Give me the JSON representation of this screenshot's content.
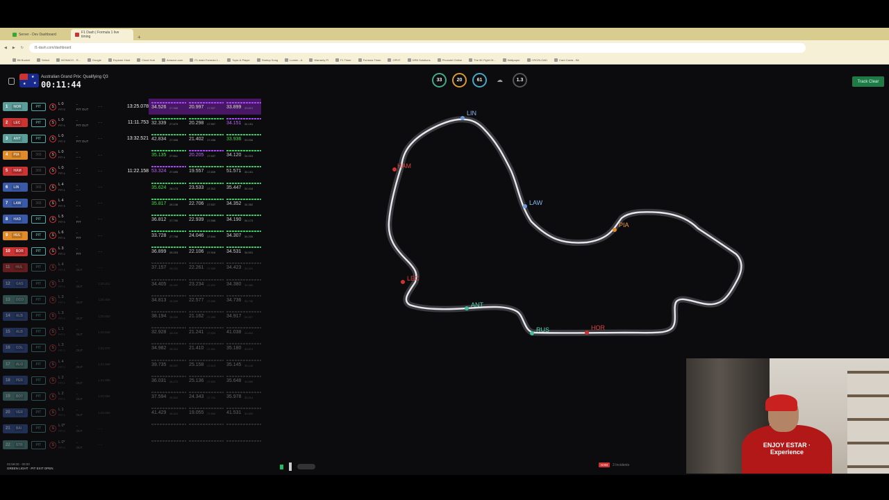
{
  "browser": {
    "tabs": [
      {
        "label": "Server - Dev Dashboard",
        "color": "#3a3"
      },
      {
        "label": "F1 Dash | Formula 1 live timing",
        "color": "#c33",
        "active": true
      }
    ],
    "new_tab": "+",
    "url": "f1-dash.com/dashboard",
    "bookmarks": [
      "Bit Bucket",
      "Select",
      "MONACO - R...",
      "Google",
      "Explorer Host",
      "Cloud Hub",
      "Amazon.com",
      "F1 dash Formula 1...",
      "Topic & Player",
      "Startup Song",
      "Lumen - A",
      "Warranty Fl",
      "F1 Timer",
      "Formula Timer",
      "OPHT",
      "DRB Solutions",
      "Phonotel Online",
      "The 5K Fight Of...",
      "Wallpaper",
      "CROSLOAD",
      "Card Cards - Bit"
    ]
  },
  "header": {
    "session_title": "Australian Grand Prix: Qualifying Q3",
    "session_timer": "00:11:44",
    "weather": {
      "air_temp": "33",
      "track_temp": "20",
      "humidity": "61",
      "rain_icon": "rain-cloud-icon",
      "wind": "1.3"
    },
    "track_status": "Track Clear"
  },
  "timing": {
    "drivers": [
      {
        "pos": "1",
        "code": "NOR",
        "color": "#5a9d9a",
        "drs": "PIT",
        "tyre": "S",
        "lap": "L 0",
        "lap_sub": "PIT 5",
        "gap": "–",
        "gap_sub": "PIT OUT",
        "interval": "– –",
        "best": "13:25.078",
        "s1": "34.526",
        "s1c": "yellow",
        "s1b": "purple",
        "s2": "20.997",
        "s2c": "yellow",
        "s2b": "purple",
        "s3": "33.899",
        "s3c": "yellow",
        "s3b": "purple",
        "s1s": "27.968",
        "s2s": "17.557",
        "s3s": "33.821",
        "highlight": true,
        "faded": false
      },
      {
        "pos": "2",
        "code": "LEC",
        "color": "#c33",
        "drs": "PIT",
        "tyre": "S",
        "lap": "L 0",
        "lap_sub": "PIT 4",
        "gap": "–",
        "gap_sub": "PIT OUT",
        "interval": "– –",
        "best": "11:11.753",
        "s1": "32.339",
        "s1c": "normal",
        "s1b": "green",
        "s2": "20.298",
        "s2c": "normal",
        "s2b": "green",
        "s3": "34.151",
        "s3c": "purple",
        "s3b": "purple",
        "s1s": "27.679",
        "s2s": "17.557",
        "s3s": "34.151",
        "highlight": false,
        "faded": false
      },
      {
        "pos": "3",
        "code": "ANT",
        "color": "#5a9d9a",
        "drs": "PIT",
        "tyre": "S",
        "lap": "L 0",
        "lap_sub": "PIT 3",
        "gap": "–",
        "gap_sub": "PIT OUT",
        "interval": "– –",
        "best": "13:32.521",
        "s1": "42.834",
        "s1c": "normal",
        "s1b": "green",
        "s2": "21.402",
        "s2c": "normal",
        "s2b": "green",
        "s3": "33.936",
        "s3c": "green",
        "s3b": "green",
        "s1s": "27.908",
        "s2s": "17.498",
        "s3s": "33.936",
        "highlight": false,
        "faded": false
      },
      {
        "pos": "4",
        "code": "PIA",
        "color": "#e08a2a",
        "drs": "365",
        "tyre": "S",
        "lap": "L 0",
        "lap_sub": "PIT 4",
        "gap": "–",
        "gap_sub": "– –",
        "interval": "– –",
        "best": "",
        "s1": "35.135",
        "s1c": "green",
        "s1b": "green",
        "s2": "20.205",
        "s2c": "purple",
        "s2b": "purple",
        "s3": "34.120",
        "s3c": "normal",
        "s3b": "green",
        "s1s": "27.811",
        "s2s": "17.537",
        "s3s": "34.003",
        "highlight": false,
        "faded": false
      },
      {
        "pos": "5",
        "code": "HAM",
        "color": "#c33",
        "drs": "365",
        "tyre": "S",
        "lap": "L 0",
        "lap_sub": "PIT 4",
        "gap": "–",
        "gap_sub": "– –",
        "interval": "– –",
        "best": "11:22.158",
        "s1": "53.324",
        "s1c": "purple",
        "s1b": "purple",
        "s2": "19.557",
        "s2c": "normal",
        "s2b": "green",
        "s3": "51.571",
        "s3c": "normal",
        "s3b": "green",
        "s1s": "27.695",
        "s2s": "17.609",
        "s3s": "34.161",
        "highlight": false,
        "faded": false
      },
      {
        "pos": "6",
        "code": "LIN",
        "color": "#3a5aa8",
        "drs": "365",
        "tyre": "S",
        "lap": "L 4",
        "lap_sub": "PIT 1",
        "gap": "–",
        "gap_sub": "– –",
        "interval": "– –",
        "best": "",
        "s1": "35.624",
        "s1c": "green",
        "s1b": "green",
        "s2": "23.533",
        "s2c": "normal",
        "s2b": "green",
        "s3": "35.447",
        "s3c": "normal",
        "s3b": "green",
        "s1s": "28.173",
        "s2s": "17.312",
        "s3s": "34.418",
        "highlight": false,
        "faded": false
      },
      {
        "pos": "7",
        "code": "LAW",
        "color": "#3a5aa8",
        "drs": "365",
        "tyre": "S",
        "lap": "L 4",
        "lap_sub": "PIT 3",
        "gap": "–",
        "gap_sub": "– –",
        "interval": "– –",
        "best": "",
        "s1": "35.817",
        "s1c": "green",
        "s1b": "green",
        "s2": "22.706",
        "s2c": "normal",
        "s2b": "green",
        "s3": "34.352",
        "s3c": "normal",
        "s3b": "green",
        "s1s": "28.138",
        "s2s": "17.537",
        "s3s": "34.352",
        "highlight": false,
        "faded": false
      },
      {
        "pos": "8",
        "code": "HAD",
        "color": "#3a5aa8",
        "drs": "PIT",
        "tyre": "S",
        "lap": "L 5",
        "lap_sub": "PIT 3",
        "gap": "–",
        "gap_sub": "PIT",
        "interval": "– –",
        "best": "",
        "s1": "36.812",
        "s1c": "normal",
        "s1b": "green",
        "s2": "22.939",
        "s2c": "normal",
        "s2b": "green",
        "s3": "34.190",
        "s3c": "normal",
        "s3b": "green",
        "s1s": "27.790",
        "s2s": "17.558",
        "s3s": "34.173",
        "highlight": false,
        "faded": false
      },
      {
        "pos": "9",
        "code": "HUL",
        "color": "#e08a2a",
        "drs": "PIT",
        "tyre": "S",
        "lap": "L 6",
        "lap_sub": "PIT 4",
        "gap": "–",
        "gap_sub": "PIT",
        "interval": "– –",
        "best": "",
        "s1": "33.728",
        "s1c": "normal",
        "s1b": "green",
        "s2": "24.046",
        "s2c": "normal",
        "s2b": "green",
        "s3": "34.307",
        "s3c": "normal",
        "s3b": "green",
        "s1s": "27.798",
        "s2s": "17.644",
        "s3s": "34.226",
        "highlight": false,
        "faded": false
      },
      {
        "pos": "10",
        "code": "BOR",
        "color": "#c33",
        "drs": "PIT",
        "tyre": "S",
        "lap": "L 3",
        "lap_sub": "PIT 2",
        "gap": "–",
        "gap_sub": "PIT",
        "interval": "– –",
        "best": "",
        "s1": "36.899",
        "s1c": "normal",
        "s1b": "green",
        "s2": "22.106",
        "s2c": "normal",
        "s2b": "green",
        "s3": "34.531",
        "s3c": "normal",
        "s3b": "green",
        "s1s": "28.203",
        "s2s": "17.918",
        "s3s": "34.531",
        "highlight": false,
        "faded": false
      },
      {
        "pos": "11",
        "code": "HUL",
        "color": "#c33",
        "drs": "PIT",
        "tyre": "S",
        "lap": "L 4",
        "lap_sub": "PIT 3",
        "gap": "–",
        "gap_sub": "OUT",
        "interval": "– –",
        "best": "",
        "s1": "37.157",
        "s1c": "normal",
        "s1b": "grey",
        "s2": "22.261",
        "s2c": "normal",
        "s2b": "grey",
        "s3": "34.423",
        "s3c": "normal",
        "s3b": "grey",
        "s1s": "28.231",
        "s2s": "17.555",
        "s3s": "34.423",
        "highlight": false,
        "faded": true
      },
      {
        "pos": "12",
        "code": "GAS",
        "color": "#3a5aa8",
        "drs": "PIT",
        "tyre": "S",
        "lap": "L 3",
        "lap_sub": "PIT 2",
        "gap": "–",
        "gap_sub": "OUT",
        "interval": "1:20.311",
        "best": "",
        "s1": "34.405",
        "s1c": "normal",
        "s1b": "grey",
        "s2": "23.234",
        "s2c": "normal",
        "s2b": "grey",
        "s3": "34.380",
        "s3c": "normal",
        "s3b": "grey",
        "s1s": "28.492",
        "s2s": "17.631",
        "s3s": "34.380",
        "highlight": false,
        "faded": true
      },
      {
        "pos": "13",
        "code": "OCO",
        "color": "#5a9d9a",
        "drs": "PIT",
        "tyre": "S",
        "lap": "L 3",
        "lap_sub": "PIT 2",
        "gap": "–",
        "gap_sub": "OUT",
        "interval": "1:20.405",
        "best": "",
        "s1": "34.813",
        "s1c": "normal",
        "s1b": "grey",
        "s2": "22.577",
        "s2c": "normal",
        "s2b": "grey",
        "s3": "34.736",
        "s3c": "normal",
        "s3b": "grey",
        "s1s": "28.339",
        "s2s": "17.665",
        "s3s": "34.736",
        "highlight": false,
        "faded": true
      },
      {
        "pos": "14",
        "code": "ALB",
        "color": "#3a5aa8",
        "drs": "PIT",
        "tyre": "S",
        "lap": "L 3",
        "lap_sub": "PIT 2",
        "gap": "–",
        "gap_sub": "OUT",
        "interval": "1:20.693",
        "best": "",
        "s1": "38.194",
        "s1c": "normal",
        "s1b": "grey",
        "s2": "21.162",
        "s2c": "normal",
        "s2b": "grey",
        "s3": "34.917",
        "s3c": "normal",
        "s3b": "grey",
        "s1s": "28.200",
        "s2s": "17.490",
        "s3s": "34.917",
        "highlight": false,
        "faded": true
      },
      {
        "pos": "15",
        "code": "ALB",
        "color": "#3a5aa8",
        "drs": "PIT",
        "tyre": "S",
        "lap": "L 1",
        "lap_sub": "PIT 2",
        "gap": "–",
        "gap_sub": "OUT",
        "interval": "1:20.848",
        "best": "",
        "s1": "32.928",
        "s1c": "normal",
        "s1b": "grey",
        "s2": "21.241",
        "s2c": "normal",
        "s2b": "grey",
        "s3": "41.038",
        "s3c": "normal",
        "s3b": "grey",
        "s1s": "28.220",
        "s2s": "17.529",
        "s3s": "34.800",
        "highlight": false,
        "faded": true
      },
      {
        "pos": "16",
        "code": "COL",
        "color": "#3a5aa8",
        "drs": "PIT",
        "tyre": "S",
        "lap": "L 3",
        "lap_sub": "PIT 2",
        "gap": "–",
        "gap_sub": "OUT",
        "interval": "1:21.070",
        "best": "",
        "s1": "34.982",
        "s1c": "normal",
        "s1b": "grey",
        "s2": "21.410",
        "s2c": "normal",
        "s2b": "grey",
        "s3": "35.180",
        "s3c": "normal",
        "s3b": "grey",
        "s1s": "28.310",
        "s2s": "17.451",
        "s3s": "34.874",
        "highlight": false,
        "faded": true
      },
      {
        "pos": "17",
        "code": "ALO",
        "color": "#5a9d9a",
        "drs": "PIT",
        "tyre": "S",
        "lap": "L 4",
        "lap_sub": "PIT 2",
        "gap": "–",
        "gap_sub": "OUT",
        "interval": "1:21.669",
        "best": "",
        "s1": "39.735",
        "s1c": "normal",
        "s1b": "grey",
        "s2": "25.158",
        "s2c": "normal",
        "s2b": "grey",
        "s3": "35.145",
        "s3c": "normal",
        "s3b": "grey",
        "s1s": "28.297",
        "s2s": "17.613",
        "s3s": "35.145",
        "highlight": false,
        "faded": true
      },
      {
        "pos": "18",
        "code": "PER",
        "color": "#3a5aa8",
        "drs": "PIT",
        "tyre": "S",
        "lap": "L 2",
        "lap_sub": "PIT 2",
        "gap": "–",
        "gap_sub": "OUT",
        "interval": "1:21.899",
        "best": "",
        "s1": "36.031",
        "s1c": "normal",
        "s1b": "grey",
        "s2": "25.136",
        "s2c": "normal",
        "s2b": "grey",
        "s3": "35.648",
        "s3c": "normal",
        "s3b": "grey",
        "s1s": "28.273",
        "s2s": "17.620",
        "s3s": "34.869",
        "highlight": false,
        "faded": true
      },
      {
        "pos": "19",
        "code": "BOT",
        "color": "#5a9d9a",
        "drs": "PIT",
        "tyre": "S",
        "lap": "L 2",
        "lap_sub": "PIT 2",
        "gap": "–",
        "gap_sub": "OUT",
        "interval": "1:22.084",
        "best": "",
        "s1": "37.594",
        "s1c": "normal",
        "s1b": "grey",
        "s2": "24.343",
        "s2c": "normal",
        "s2b": "grey",
        "s3": "35.978",
        "s3c": "normal",
        "s3b": "grey",
        "s1s": "28.302",
        "s2s": "17.731",
        "s3s": "35.214",
        "highlight": false,
        "faded": true
      },
      {
        "pos": "20",
        "code": "VER",
        "color": "#3a5aa8",
        "drs": "PIT",
        "tyre": "S",
        "lap": "L 1",
        "lap_sub": "PIT 1",
        "gap": "–",
        "gap_sub": "OUT",
        "interval": "1:23.056",
        "best": "",
        "s1": "41.429",
        "s1c": "normal",
        "s1b": "grey",
        "s2": "19.055",
        "s2c": "normal",
        "s2b": "grey",
        "s3": "41.531",
        "s3c": "normal",
        "s3b": "grey",
        "s1s": "28.441",
        "s2s": "17.660",
        "s3s": "34.800",
        "highlight": false,
        "faded": true
      },
      {
        "pos": "21",
        "code": "BAI",
        "color": "#3a5aa8",
        "drs": "PIT",
        "tyre": "S",
        "lap": "L 0*",
        "lap_sub": "PIT 0",
        "gap": "–",
        "gap_sub": "OUT",
        "interval": "– –",
        "best": "",
        "s1": "",
        "s1c": "normal",
        "s1b": "grey",
        "s2": "",
        "s2c": "normal",
        "s2b": "grey",
        "s3": "",
        "s3c": "normal",
        "s3b": "grey",
        "s1s": "",
        "s2s": "",
        "s3s": "",
        "highlight": false,
        "faded": true
      },
      {
        "pos": "22",
        "code": "STR",
        "color": "#5a9d9a",
        "drs": "PIT",
        "tyre": "S",
        "lap": "L 0*",
        "lap_sub": "PIT 0",
        "gap": "–",
        "gap_sub": "OUT",
        "interval": "– –",
        "best": "",
        "s1": "",
        "s1c": "normal",
        "s1b": "grey",
        "s2": "",
        "s2c": "normal",
        "s2b": "grey",
        "s3": "",
        "s3c": "normal",
        "s3b": "grey",
        "s1s": "",
        "s2s": "",
        "s3s": "",
        "highlight": false,
        "faded": true
      }
    ]
  },
  "trackmap": {
    "cars": [
      {
        "code": "LIN",
        "color": "#6a9ad8",
        "label_color": "#8ab8ee"
      },
      {
        "code": "HAM",
        "color": "#d03030",
        "label_color": "#e04040"
      },
      {
        "code": "LAW",
        "color": "#6a9ad8",
        "label_color": "#8ab8ee"
      },
      {
        "code": "PIA",
        "color": "#e08a2a",
        "label_color": "#e89a3a"
      },
      {
        "code": "LEC",
        "color": "#d03030",
        "label_color": "#e04040"
      },
      {
        "code": "ANT",
        "color": "#40c0a0",
        "label_color": "#5ad8b8"
      },
      {
        "code": "RUS",
        "color": "#40c0a0",
        "label_color": "#5ad8b8"
      },
      {
        "code": "HOR",
        "color": "#d03030",
        "label_color": "#e04040"
      }
    ]
  },
  "footer": {
    "status_line1": "02:59:00 · 00:00",
    "status_line2": "GREEN LIGHT · PIT EXIT OPEN",
    "msg_tag": "HAM",
    "msg_text": "3 Incidents"
  },
  "webcam": {
    "shirt_text": "ENJOY ESTAR · Experience"
  }
}
